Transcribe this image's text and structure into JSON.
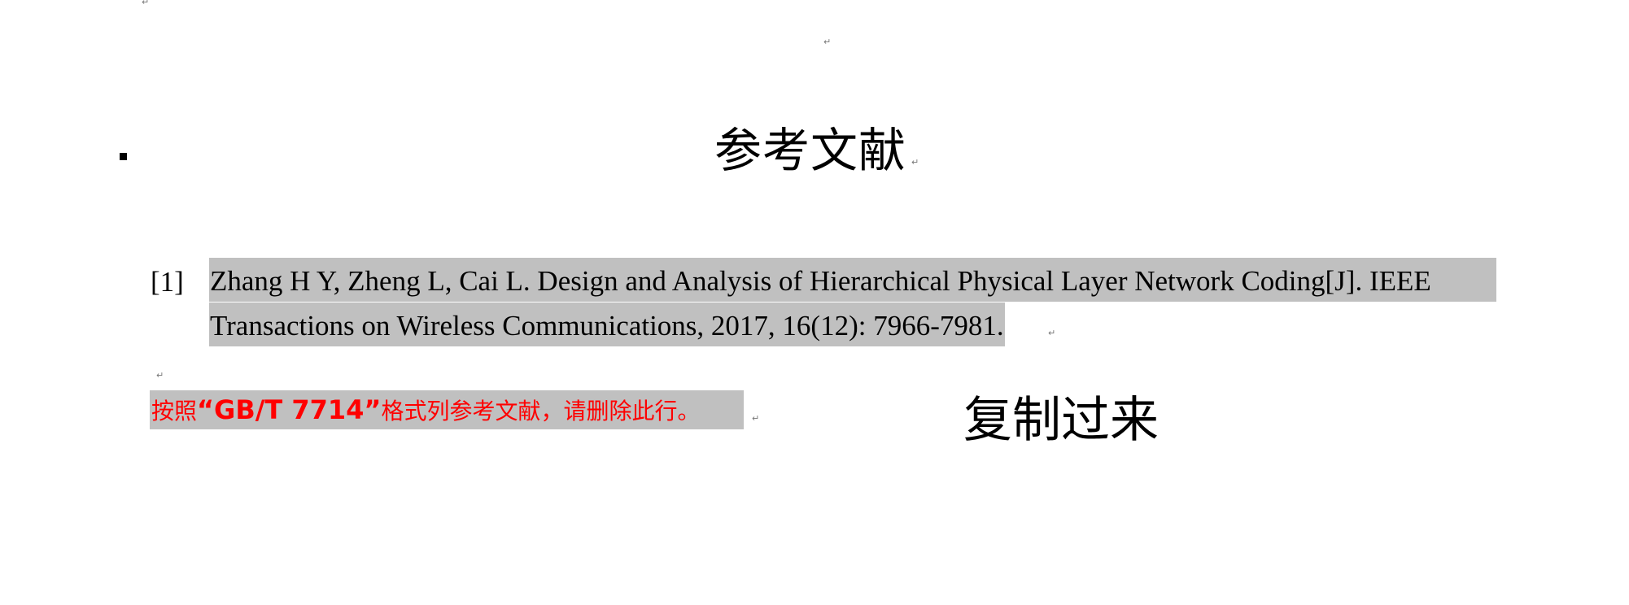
{
  "paragraph_mark": "↵",
  "heading": {
    "title": "参考文献"
  },
  "references": [
    {
      "number": "[1]",
      "line1": "Zhang H Y, Zheng L, Cai L. Design and Analysis of Hierarchical Physical Layer Network Coding[J]. IEEE",
      "line2": "Transactions on Wireless Communications, 2017, 16(12): 7966-7981."
    }
  ],
  "note": {
    "prefix": "按照",
    "bold": "“GB/T 7714”",
    "suffix": "格式列参考文献，请删除此行。",
    "color": "#ff0000",
    "highlight": "#c0c0c0"
  },
  "overlay_text": "复制过来"
}
